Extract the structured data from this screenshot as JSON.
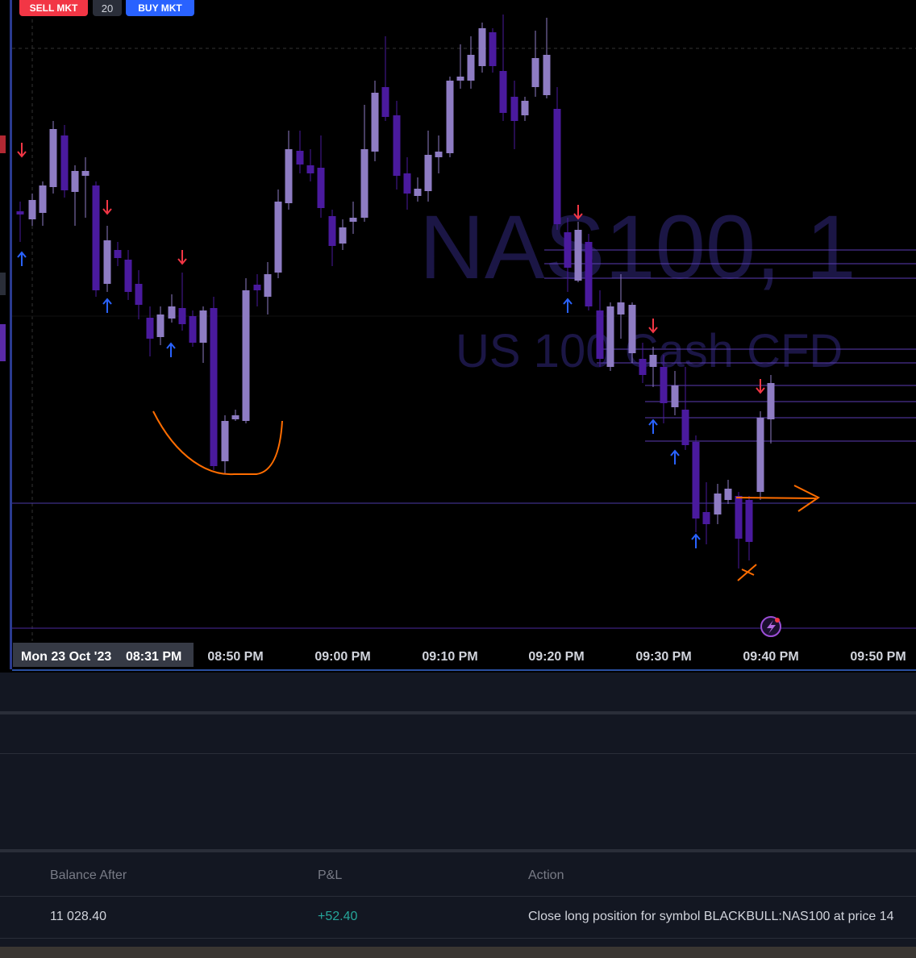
{
  "toolbar": {
    "sell_label": "SELL MKT",
    "quantity": "20",
    "buy_label": "BUY MKT"
  },
  "chart_data": {
    "type": "candlestick",
    "watermark": {
      "symbol": "NAS100, 1",
      "description": "US 100 Cash CFD"
    },
    "x_axis": {
      "date_label": "Mon 23 Oct '23",
      "crosshair_time": "08:31 PM",
      "ticks": [
        "08:50 PM",
        "09:00 PM",
        "09:10 PM",
        "09:20 PM",
        "09:30 PM",
        "09:40 PM",
        "09:50 PM"
      ]
    },
    "bullish_color": "#8e7cc3",
    "bearish_color": "#4a1a9e",
    "signal_up_color": "#2962ff",
    "signal_down_color": "#f23645",
    "annotation_color": "#ff6d00"
  },
  "trade_table": {
    "headers": {
      "balance_after": "Balance After",
      "pnl": "P&L",
      "action": "Action"
    },
    "rows": [
      {
        "balance_after": "11 028.40",
        "pnl": "+52.40",
        "action": "Close long position for symbol BLACKBULL:NAS100 at price 14"
      }
    ]
  }
}
